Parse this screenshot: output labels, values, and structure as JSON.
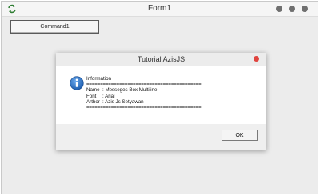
{
  "window": {
    "title": "Form1",
    "command_button_label": "Command1"
  },
  "dialog": {
    "title": "Tutorial AzisJS",
    "heading": "Information",
    "separator": "==========================================",
    "rows": [
      {
        "key": "Name",
        "value": ": Messeges Box Multiline"
      },
      {
        "key": "Font",
        "value": ": Arial"
      },
      {
        "key": "Arthor",
        "value": ": Azis Js Setyawan"
      }
    ],
    "ok_label": "OK"
  },
  "colors": {
    "close_dot": "#e0443e",
    "info_icon": "#1f5fb0"
  }
}
